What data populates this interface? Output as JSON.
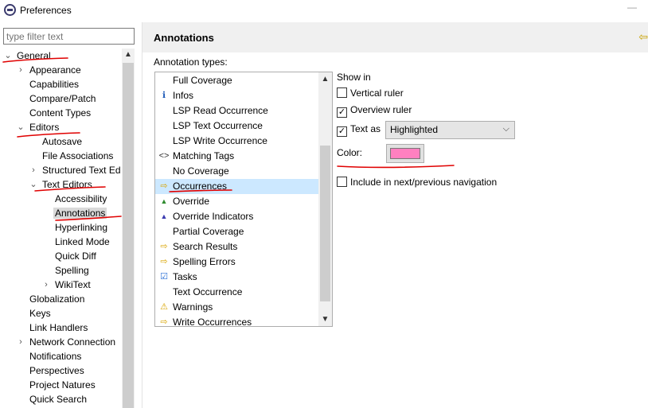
{
  "window": {
    "title": "Preferences",
    "controls": "—"
  },
  "filter": {
    "placeholder": "type filter text"
  },
  "tree": {
    "items": [
      {
        "label": "General",
        "twisty": "⌄"
      },
      {
        "label": "Appearance",
        "twisty": "›"
      },
      {
        "label": "Capabilities",
        "twisty": ""
      },
      {
        "label": "Compare/Patch",
        "twisty": ""
      },
      {
        "label": "Content Types",
        "twisty": ""
      },
      {
        "label": "Editors",
        "twisty": "⌄"
      },
      {
        "label": "Autosave",
        "twisty": ""
      },
      {
        "label": "File Associations",
        "twisty": ""
      },
      {
        "label": "Structured Text Ed",
        "twisty": "›"
      },
      {
        "label": "Text Editors",
        "twisty": "⌄"
      },
      {
        "label": "Accessibility",
        "twisty": ""
      },
      {
        "label": "Annotations",
        "twisty": ""
      },
      {
        "label": "Hyperlinking",
        "twisty": ""
      },
      {
        "label": "Linked Mode",
        "twisty": ""
      },
      {
        "label": "Quick Diff",
        "twisty": ""
      },
      {
        "label": "Spelling",
        "twisty": ""
      },
      {
        "label": "WikiText",
        "twisty": "›"
      },
      {
        "label": "Globalization",
        "twisty": ""
      },
      {
        "label": "Keys",
        "twisty": ""
      },
      {
        "label": "Link Handlers",
        "twisty": ""
      },
      {
        "label": "Network Connection",
        "twisty": "›"
      },
      {
        "label": "Notifications",
        "twisty": ""
      },
      {
        "label": "Perspectives",
        "twisty": ""
      },
      {
        "label": "Project Natures",
        "twisty": ""
      },
      {
        "label": "Quick Search",
        "twisty": ""
      }
    ]
  },
  "page": {
    "title": "Annotations",
    "types_label": "Annotation types:"
  },
  "annotation_types": [
    {
      "label": "Full Coverage",
      "icon": ""
    },
    {
      "label": "Infos",
      "icon": "ℹ"
    },
    {
      "label": "LSP Read Occurrence",
      "icon": ""
    },
    {
      "label": "LSP Text Occurrence",
      "icon": ""
    },
    {
      "label": "LSP Write Occurrence",
      "icon": ""
    },
    {
      "label": "Matching Tags",
      "icon": "<>"
    },
    {
      "label": "No Coverage",
      "icon": ""
    },
    {
      "label": "Occurrences",
      "icon": "⇨"
    },
    {
      "label": "Override",
      "icon": "▲"
    },
    {
      "label": "Override Indicators",
      "icon": "▲"
    },
    {
      "label": "Partial Coverage",
      "icon": ""
    },
    {
      "label": "Search Results",
      "icon": "⇨"
    },
    {
      "label": "Spelling Errors",
      "icon": "⇨"
    },
    {
      "label": "Tasks",
      "icon": "☑"
    },
    {
      "label": "Text Occurrence",
      "icon": ""
    },
    {
      "label": "Warnings",
      "icon": "⚠"
    },
    {
      "label": "Write Occurrences",
      "icon": "⇨"
    }
  ],
  "options": {
    "show_in": "Show in",
    "vertical_ruler": {
      "label": "Vertical ruler",
      "checked": false
    },
    "overview_ruler": {
      "label": "Overview ruler",
      "checked": true
    },
    "text_as": {
      "label": "Text as",
      "checked": true,
      "value": "Highlighted"
    },
    "color_label": "Color:",
    "color_value": "#ff80c0",
    "include_nav": {
      "label": "Include in next/previous navigation",
      "checked": false
    }
  },
  "icons": {
    "up": "▲",
    "down": "▼",
    "chevron": "⌵",
    "check": "✓",
    "nav": "⇦"
  },
  "accent": {
    "selection": "#cce8ff",
    "annotation_ink": "#e00000"
  }
}
